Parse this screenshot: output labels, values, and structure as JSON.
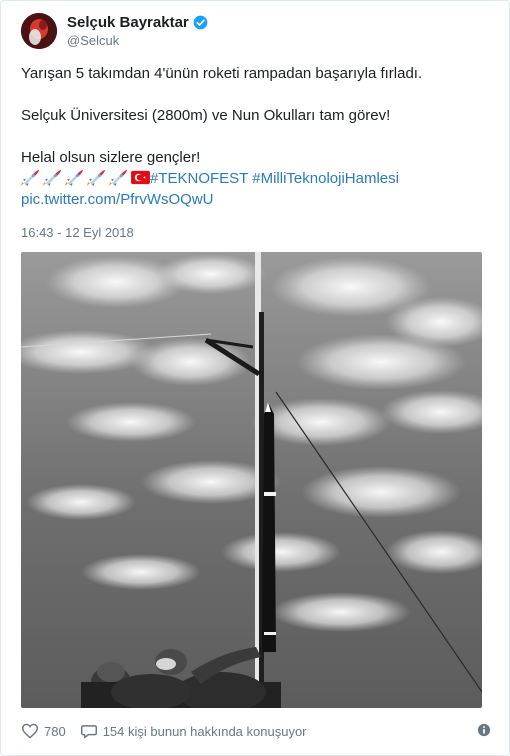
{
  "user": {
    "display_name": "Selçuk Bayraktar",
    "handle": "@Selcuk",
    "verified": true,
    "avatar_icon": "avatar-photo"
  },
  "tweet": {
    "line1": "Yarışan 5 takımdan 4'ünün roketi rampadan başarıyla fırladı.",
    "line2": "Selçuk Üniversitesi (2800m) ve Nun Okulları tam görev!",
    "line3": "Helal olsun sizlere gençler!",
    "emojis": [
      "rocket-emoji",
      "rocket-emoji",
      "rocket-emoji",
      "rocket-emoji",
      "rocket-emoji",
      "turkey-flag-emoji"
    ],
    "hashtag1": "#TEKNOFEST",
    "hashtag2": "#MilliTeknolojiHamlesi",
    "pic_link": "pic.twitter.com/PfrvWsOQwU",
    "timestamp": "16:43 - 12 Eyl 2018"
  },
  "actions": {
    "likes": "780",
    "replies_text": "154 kişi bunun hakkında konuşuyor"
  },
  "colors": {
    "link": "#2b7bb9",
    "muted": "#697882",
    "verified": "#1da1f2"
  }
}
